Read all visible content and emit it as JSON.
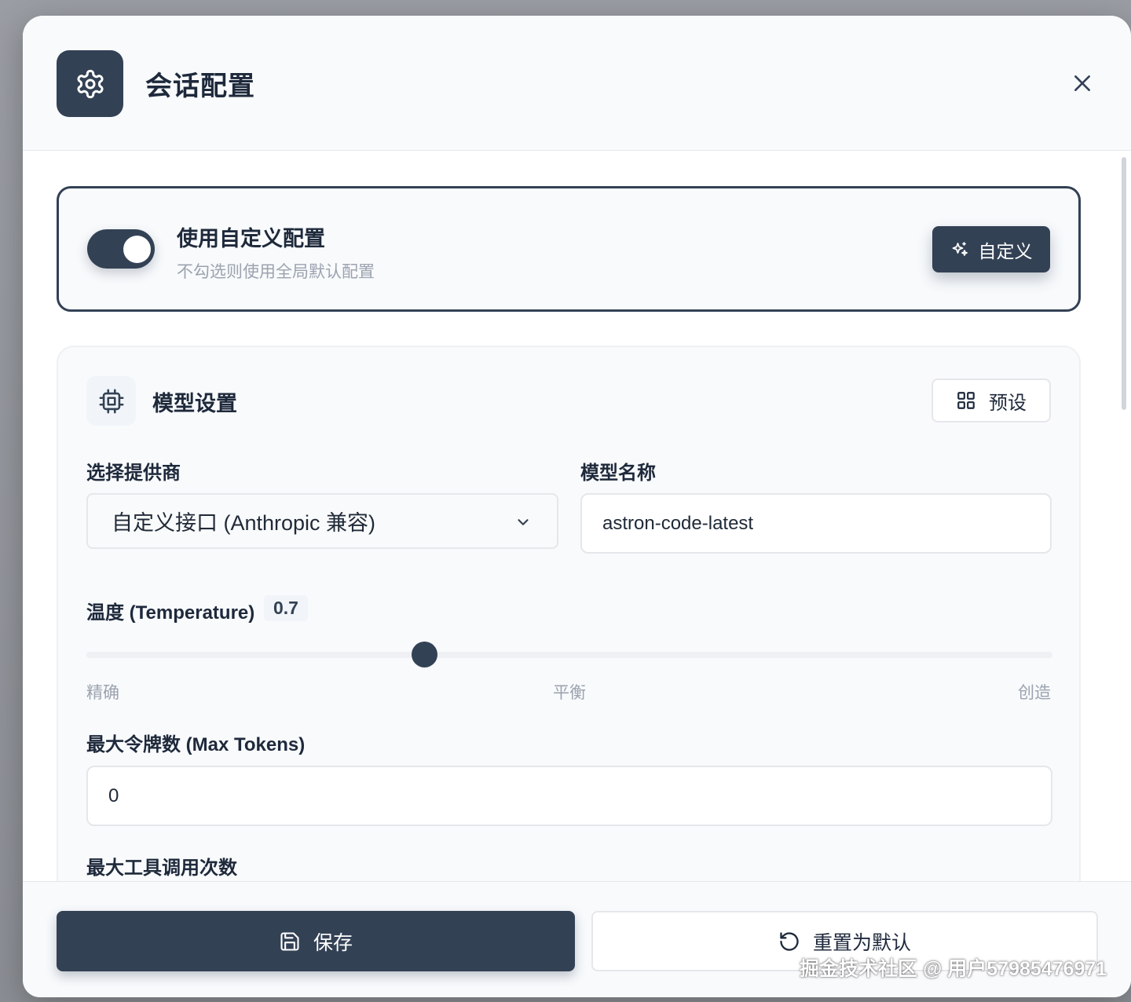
{
  "dialog": {
    "title": "会话配置",
    "header_icon": "gear-icon",
    "close_icon": "close-icon"
  },
  "custom_config": {
    "enabled": true,
    "title": "使用自定义配置",
    "subtitle": "不勾选则使用全局默认配置",
    "button_label": "自定义",
    "button_icon": "sparkles-icon"
  },
  "model_settings": {
    "title": "模型设置",
    "icon": "cpu-icon",
    "preset_label": "预设",
    "preset_icon": "grid-icon",
    "provider": {
      "label": "选择提供商",
      "value": "自定义接口 (Anthropic 兼容)"
    },
    "model_name": {
      "label": "模型名称",
      "value": "astron-code-latest"
    },
    "temperature": {
      "label": "温度 (Temperature)",
      "value": "0.7",
      "level": 0.35,
      "ticks": [
        "精确",
        "平衡",
        "创造"
      ]
    },
    "max_tokens": {
      "label": "最大令牌数 (Max Tokens)",
      "value": "0"
    },
    "max_tool_calls": {
      "label": "最大工具调用次数"
    }
  },
  "footer": {
    "save_label": "保存",
    "reset_label": "重置为默认"
  },
  "watermark": "掘金技术社区 @ 用户57985476971",
  "colors": {
    "primary": "#334155",
    "muted_text": "#9ca3af",
    "border": "#e5e7eb"
  }
}
